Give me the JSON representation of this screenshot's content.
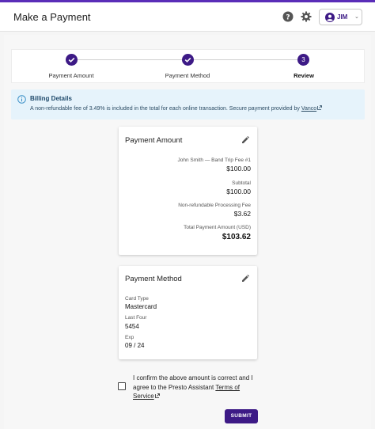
{
  "header": {
    "title": "Make a Payment",
    "user_name": "JIM",
    "help_icon": "help-circle-icon",
    "settings_icon": "gear-icon"
  },
  "stepper": {
    "steps": [
      {
        "label": "Payment Amount",
        "state": "complete",
        "marker": ""
      },
      {
        "label": "Payment Method",
        "state": "complete",
        "marker": ""
      },
      {
        "label": "Review",
        "state": "active",
        "marker": "3"
      }
    ]
  },
  "banner": {
    "title": "Billing Details",
    "text": "A non-refundable fee of 3.49% is included in the total for each online transaction. Secure payment provided by",
    "link": "Vanco"
  },
  "payment_amount": {
    "title": "Payment Amount",
    "lines": [
      {
        "label": "John Smith — Band Trip Fee #1",
        "value": "$100.00"
      },
      {
        "label": "Subtotal",
        "value": "$100.00"
      },
      {
        "label": "Non-refundable Processing Fee",
        "value": "$3.62"
      },
      {
        "label": "Total Payment Amount (USD)",
        "value": "$103.62"
      }
    ]
  },
  "payment_method": {
    "title": "Payment Method",
    "fields": [
      {
        "label": "Card Type",
        "value": "Mastercard"
      },
      {
        "label": "Last Four",
        "value": "5454"
      },
      {
        "label": "Exp",
        "value": "09 / 24"
      }
    ]
  },
  "confirm": {
    "text": "I confirm the above amount is correct and I agree to the Presto Assistant",
    "tos_link": "Terms of Service",
    "checked": false
  },
  "submit_label": "SUBMIT",
  "colors": {
    "primary": "#3d1a86",
    "banner_bg": "#e6f3fb",
    "header_accent": "#5a2db8"
  }
}
